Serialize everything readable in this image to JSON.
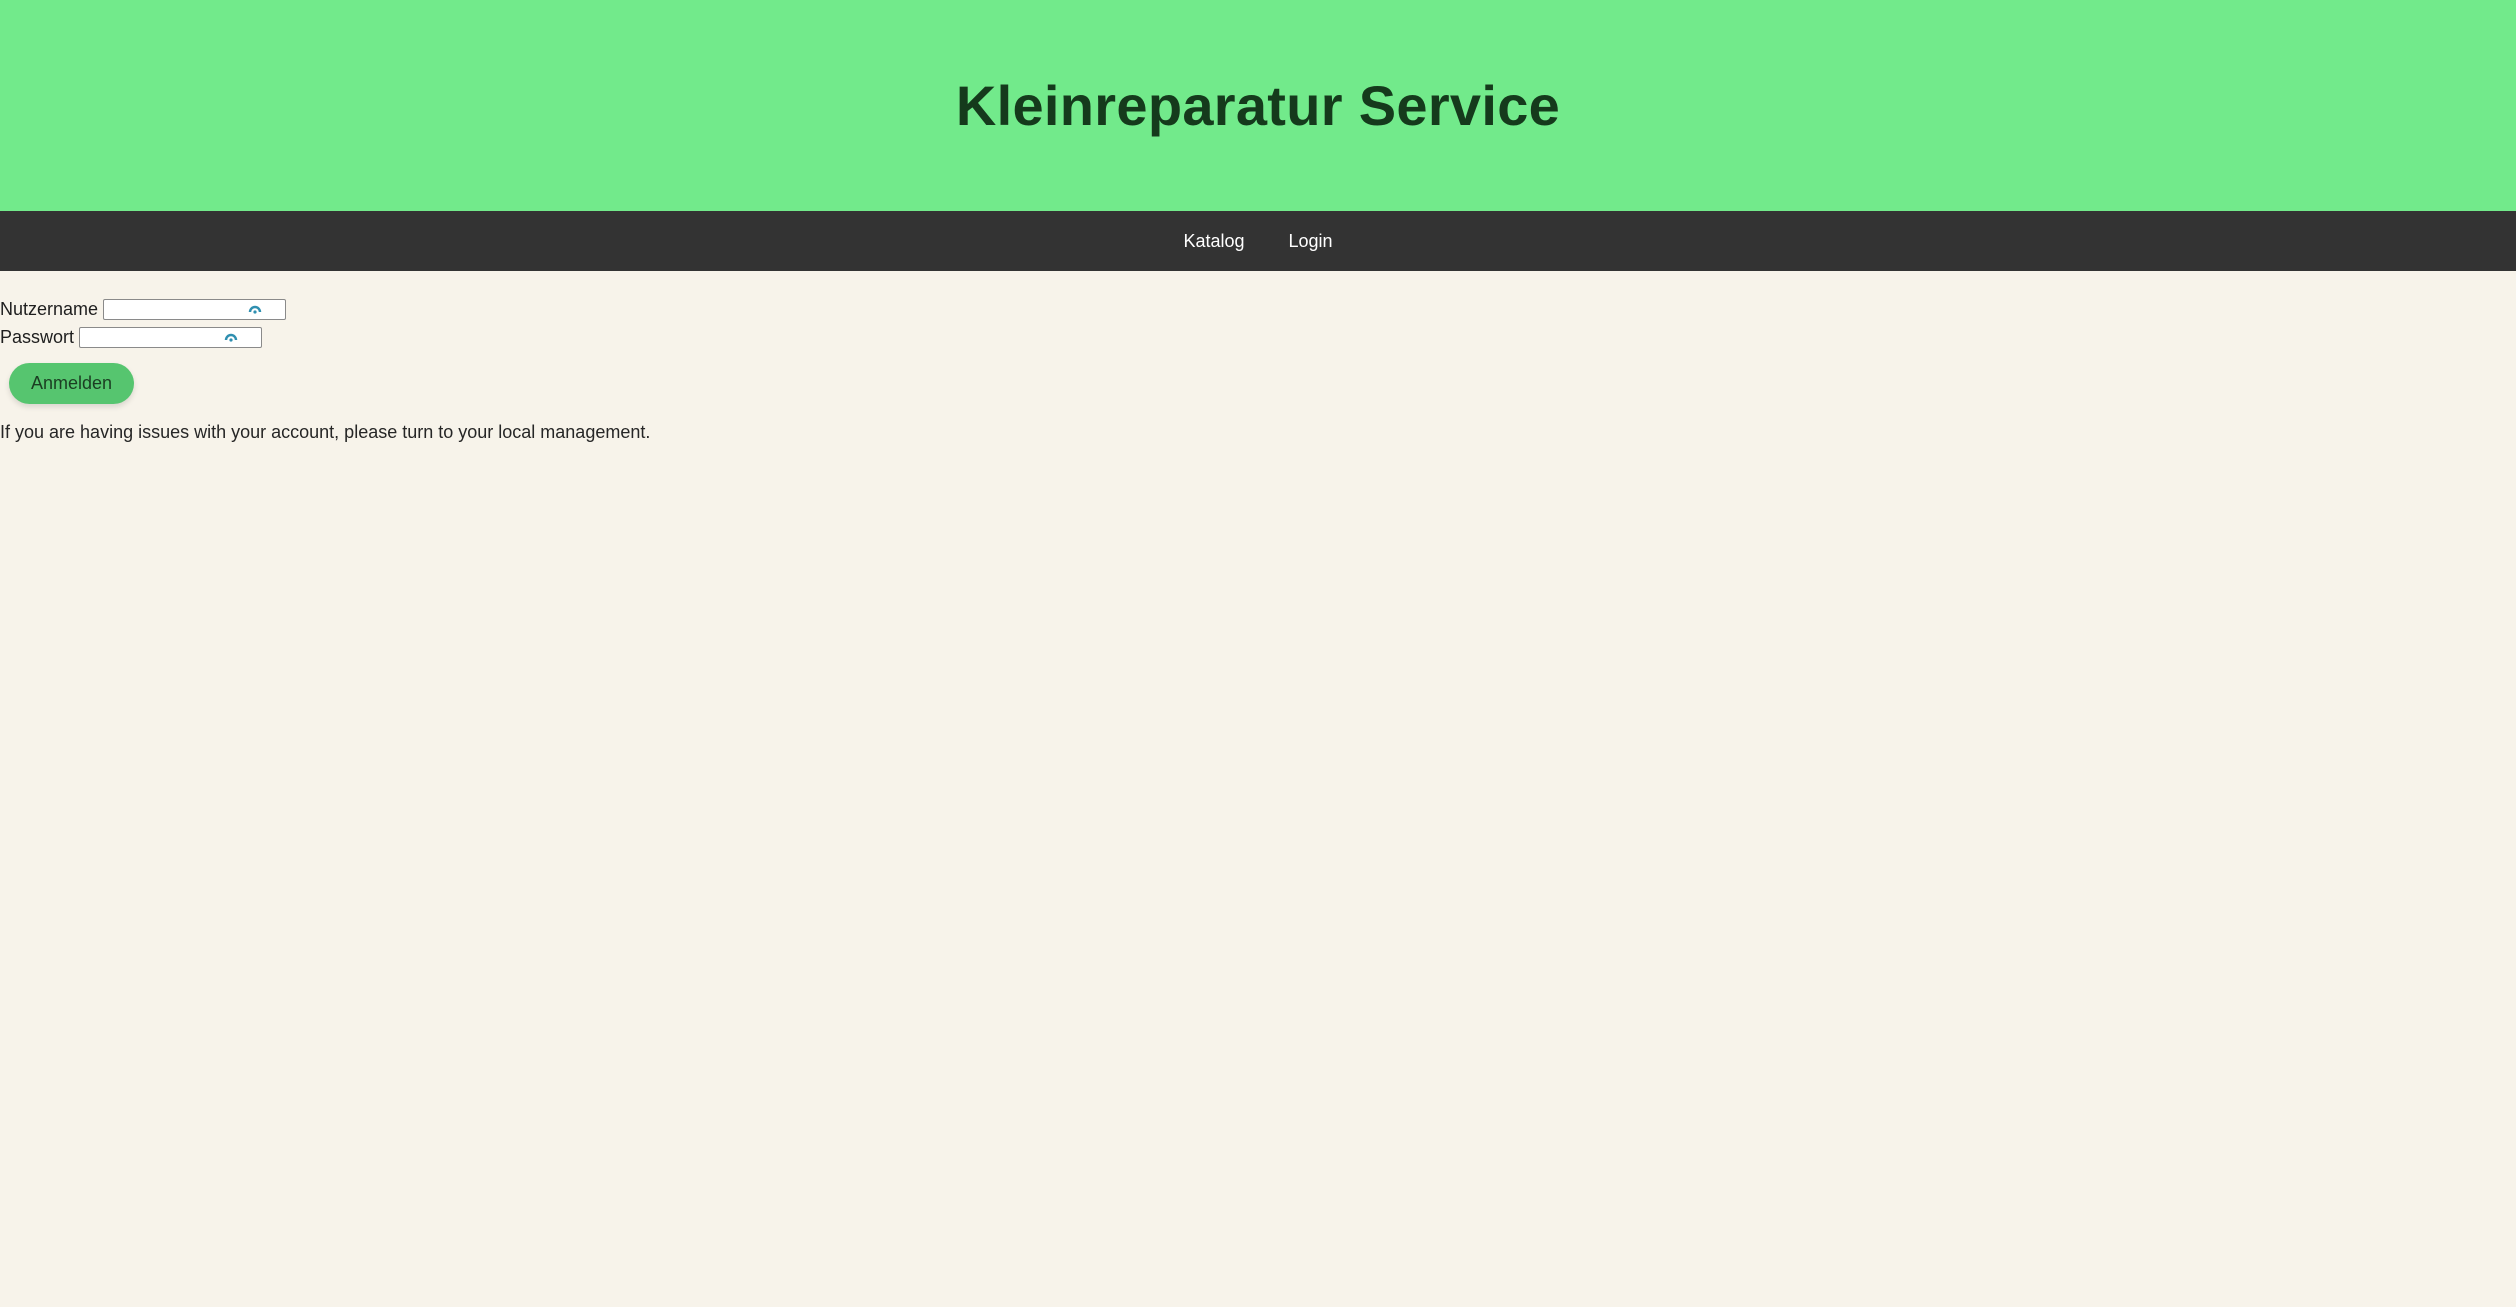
{
  "header": {
    "title": "Kleinreparatur Service"
  },
  "nav": {
    "items": [
      {
        "label": "Katalog"
      },
      {
        "label": "Login"
      }
    ]
  },
  "login_form": {
    "username_label": "Nutzername",
    "username_value": "",
    "password_label": "Passwort",
    "password_value": "",
    "submit_label": "Anmelden",
    "autofill_icon": "password-manager-icon"
  },
  "help_text": "If you are having issues with your account, please turn to your local management.",
  "colors": {
    "header_bg": "#72ea8b",
    "nav_bg": "#333333",
    "page_bg": "#f7f3ea",
    "button_bg": "#56c56f"
  }
}
